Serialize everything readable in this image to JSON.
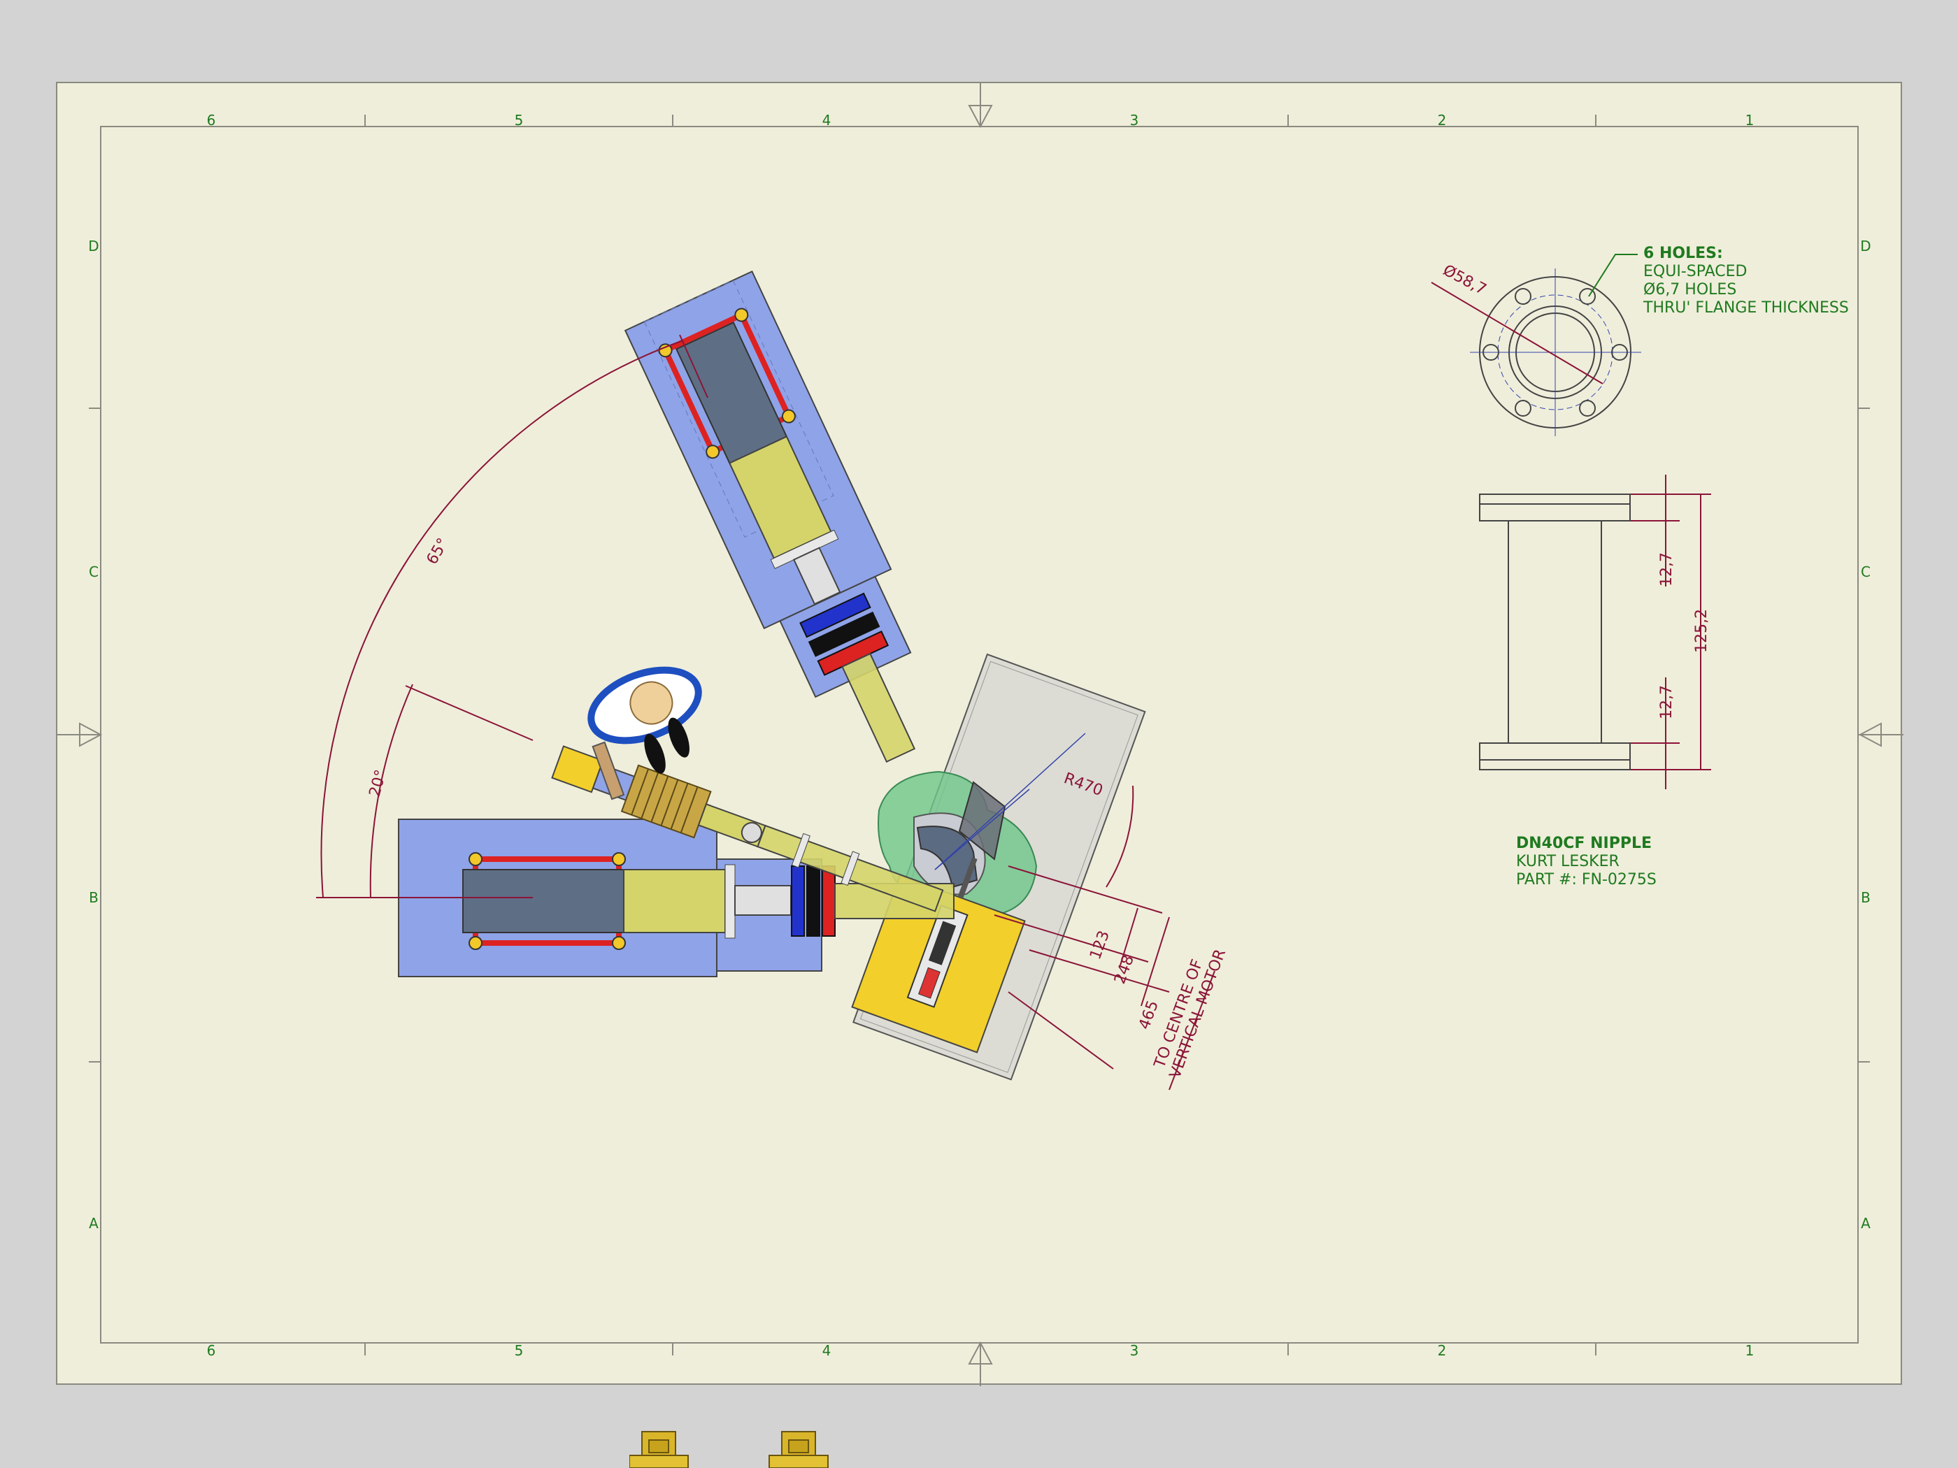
{
  "border": {
    "columns": [
      "6",
      "5",
      "4",
      "3",
      "2",
      "1"
    ],
    "rows": [
      "D",
      "C",
      "B",
      "A"
    ]
  },
  "layout_dims": {
    "angle_65": "65°",
    "angle_20": "20°",
    "radius": "R470",
    "d123": "123",
    "d248": "248",
    "d465": "465",
    "motor_note_line1": "TO CENTRE OF",
    "motor_note_line2": "VERTICAL MOTOR"
  },
  "flange_detail": {
    "diameter": "Ø58,7",
    "holes_title": "6 HOLES:",
    "holes_line1": "EQUI-SPACED",
    "holes_line2": "Ø6,7 HOLES",
    "holes_line3": "THRU' FLANGE THICKNESS"
  },
  "nipple_detail": {
    "dim_top": "12,7",
    "dim_total": "125,2",
    "dim_bottom": "12,7"
  },
  "part_note": {
    "title": "DN40CF NIPPLE",
    "vendor": "KURT LESKER",
    "part_number": "PART #: FN-0275S"
  },
  "colors": {
    "sheet": "#efeedb",
    "border_green": "#1f7a1f",
    "dimension": "#8b1438",
    "table_blue": "#8fa3e8",
    "tube_yellow": "#d4d46a",
    "plate_yellow": "#f2cf2a",
    "chamber_green": "#6ec78a"
  },
  "thumbnails": [
    "assembly-thumbnail-1",
    "assembly-thumbnail-2"
  ]
}
